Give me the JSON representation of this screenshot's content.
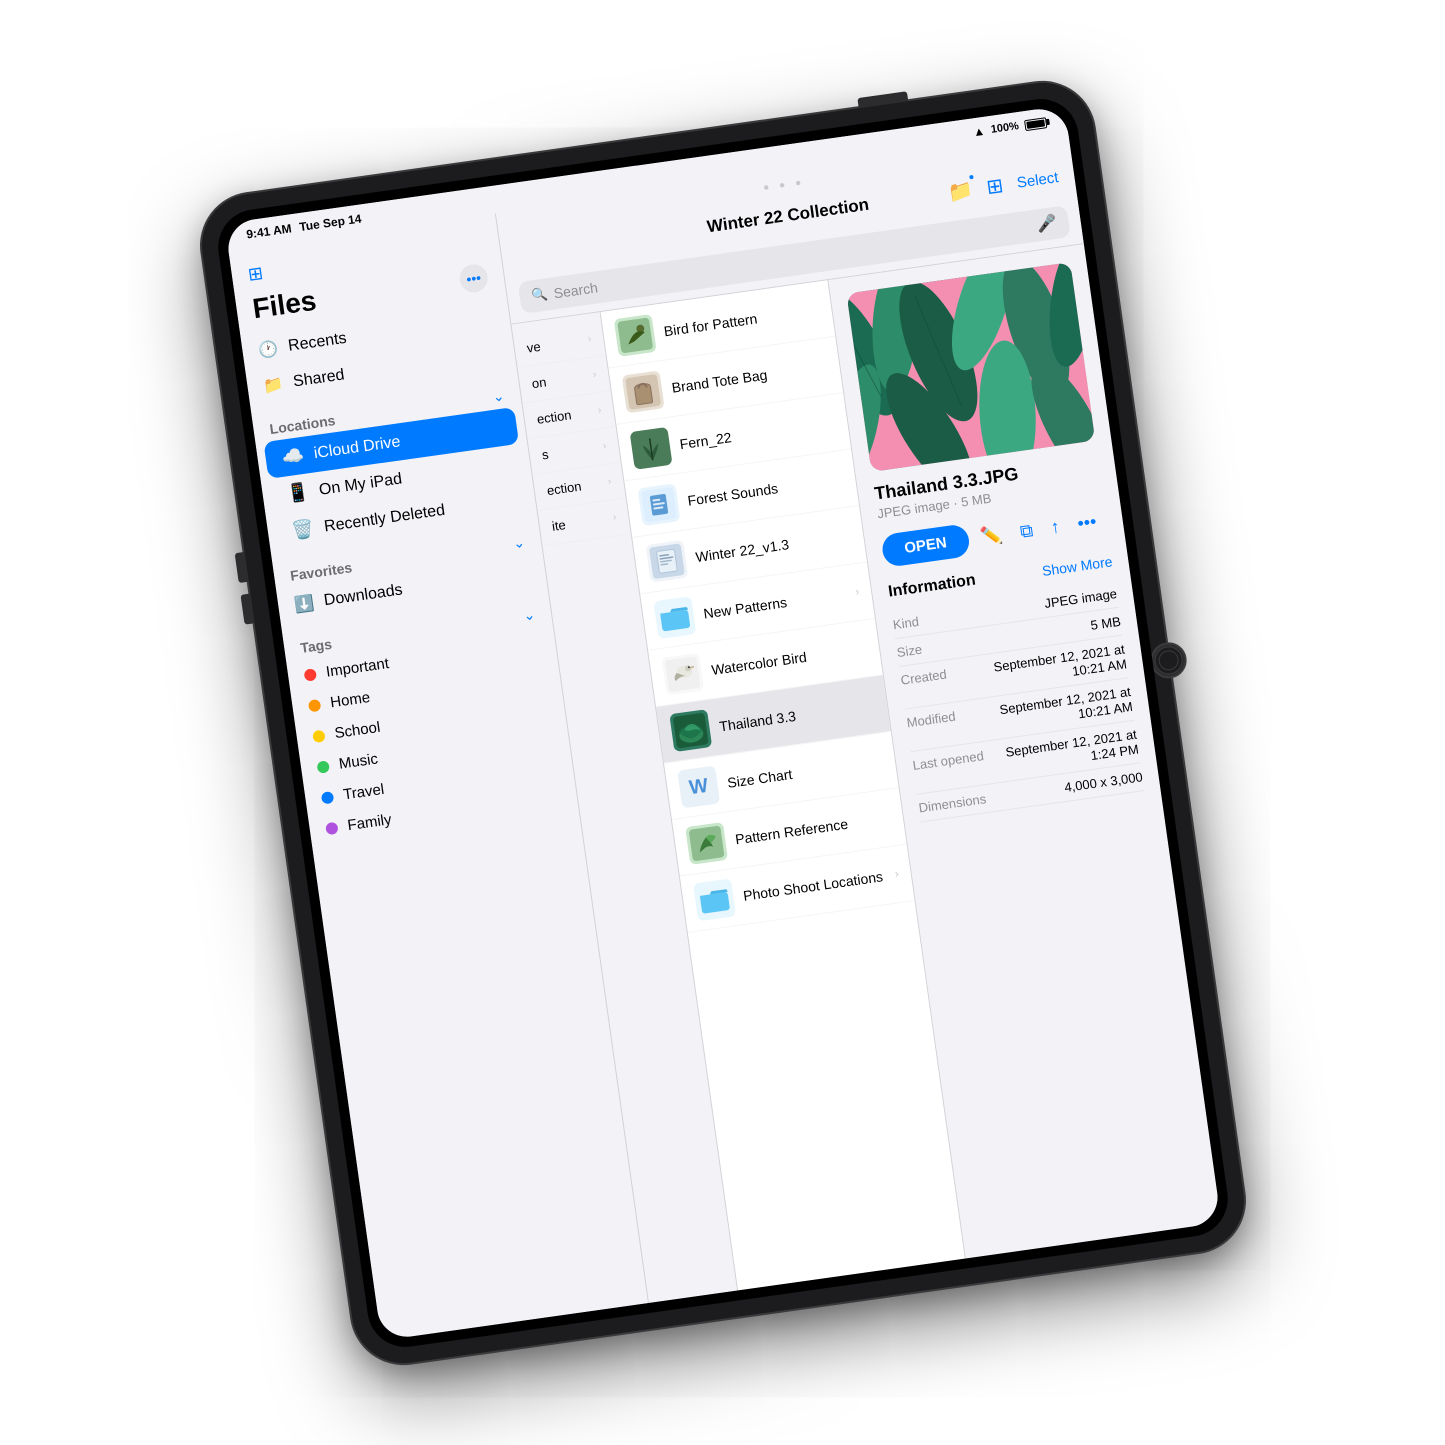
{
  "statusBar": {
    "time": "9:41 AM",
    "date": "Tue Sep 14",
    "wifi": "WiFi",
    "battery": "100%"
  },
  "sidebar": {
    "title": "Files",
    "topIconLabel": "sidebar-toggle",
    "moreLabel": "more-options",
    "nav": [
      {
        "id": "recents",
        "icon": "🕐",
        "label": "Recents"
      },
      {
        "id": "shared",
        "icon": "📁",
        "label": "Shared"
      }
    ],
    "locationsTitle": "Locations",
    "locations": [
      {
        "id": "icloud",
        "icon": "☁️",
        "label": "iCloud Drive",
        "active": true
      },
      {
        "id": "ipad",
        "icon": "📱",
        "label": "On My iPad",
        "active": false
      },
      {
        "id": "deleted",
        "icon": "🗑️",
        "label": "Recently Deleted",
        "active": false
      }
    ],
    "favoritesTitle": "Favorites",
    "favorites": [
      {
        "id": "downloads",
        "icon": "⬇️",
        "label": "Downloads"
      }
    ],
    "tagsTitle": "Tags",
    "tags": [
      {
        "id": "important",
        "color": "#ff3b30",
        "label": "Important"
      },
      {
        "id": "home",
        "color": "#ff9500",
        "label": "Home"
      },
      {
        "id": "school",
        "color": "#ffcc00",
        "label": "School"
      },
      {
        "id": "music",
        "color": "#34c759",
        "label": "Music"
      },
      {
        "id": "travel",
        "color": "#007aff",
        "label": "Travel"
      },
      {
        "id": "family",
        "color": "#af52de",
        "label": "Family"
      }
    ]
  },
  "navColumn": {
    "items": [
      {
        "label": "ve",
        "hasChevron": true
      },
      {
        "label": "on",
        "hasChevron": true
      },
      {
        "label": "ection",
        "hasChevron": true
      },
      {
        "label": "s",
        "hasChevron": true
      },
      {
        "label": "ection",
        "hasChevron": true
      },
      {
        "label": "ite",
        "hasChevron": true
      }
    ]
  },
  "topBar": {
    "dragHandle": "• • •",
    "title": "Winter 22 Collection",
    "folderIconLabel": "folder-icon",
    "gridIconLabel": "grid-icon",
    "selectLabel": "Select",
    "searchPlaceholder": "Search",
    "micIconLabel": "mic-icon"
  },
  "fileList": {
    "items": [
      {
        "id": "bird-pattern",
        "name": "Bird for Pattern",
        "thumbColor": "#8fbc8f",
        "thumbIcon": "🦜",
        "hasChevron": false
      },
      {
        "id": "brand-tote",
        "name": "Brand Tote Bag",
        "thumbColor": "#d4c5b2",
        "thumbIcon": "👜",
        "hasChevron": false
      },
      {
        "id": "fern22",
        "name": "Fern_22",
        "thumbColor": "#4a7c59",
        "thumbIcon": "🌿",
        "hasChevron": false
      },
      {
        "id": "forest-sounds",
        "name": "Forest Sounds",
        "thumbColor": "#5b9bd5",
        "thumbIcon": "📄",
        "hasChevron": false
      },
      {
        "id": "winter22",
        "name": "Winter 22_v1.3",
        "thumbColor": "#c8d8e8",
        "thumbIcon": "📄",
        "hasChevron": false
      },
      {
        "id": "new-patterns",
        "name": "New Patterns",
        "thumbColor": "#5bc5f5",
        "thumbIcon": "📁",
        "hasChevron": true
      },
      {
        "id": "watercolor-bird",
        "name": "Watercolor Bird",
        "thumbColor": "#f0f0f0",
        "thumbIcon": "🐦",
        "hasChevron": false
      },
      {
        "id": "thailand",
        "name": "Thailand 3.3",
        "thumbColor": "#2d7a60",
        "thumbIcon": "🌿",
        "hasChevron": false,
        "selected": true
      },
      {
        "id": "size-chart",
        "name": "Size Chart",
        "thumbColor": "#4a90d9",
        "thumbIcon": "W",
        "hasChevron": false
      },
      {
        "id": "pattern-ref",
        "name": "Pattern Reference",
        "thumbColor": "#8fbc8f",
        "thumbIcon": "🌿",
        "hasChevron": false
      },
      {
        "id": "photo-shoot",
        "name": "Photo Shoot Locations",
        "thumbColor": "#5bc5f5",
        "thumbIcon": "📁",
        "hasChevron": true
      }
    ]
  },
  "preview": {
    "filename": "Thailand 3.3.JPG",
    "subtitle": "JPEG image · 5 MB",
    "openLabel": "OPEN",
    "actions": [
      "pencil",
      "copy",
      "share",
      "more"
    ],
    "infoTitle": "Information",
    "showMoreLabel": "Show More",
    "infoRows": [
      {
        "key": "Kind",
        "value": "JPEG image"
      },
      {
        "key": "Size",
        "value": "5 MB"
      },
      {
        "key": "Created",
        "value": "September 12, 2021 at 10:21 AM"
      },
      {
        "key": "Modified",
        "value": "September 12, 2021 at 10:21 AM"
      },
      {
        "key": "Last opened",
        "value": "September 12, 2021 at 1:24 PM"
      },
      {
        "key": "Dimensions",
        "value": "4,000 x 3,000"
      }
    ]
  }
}
